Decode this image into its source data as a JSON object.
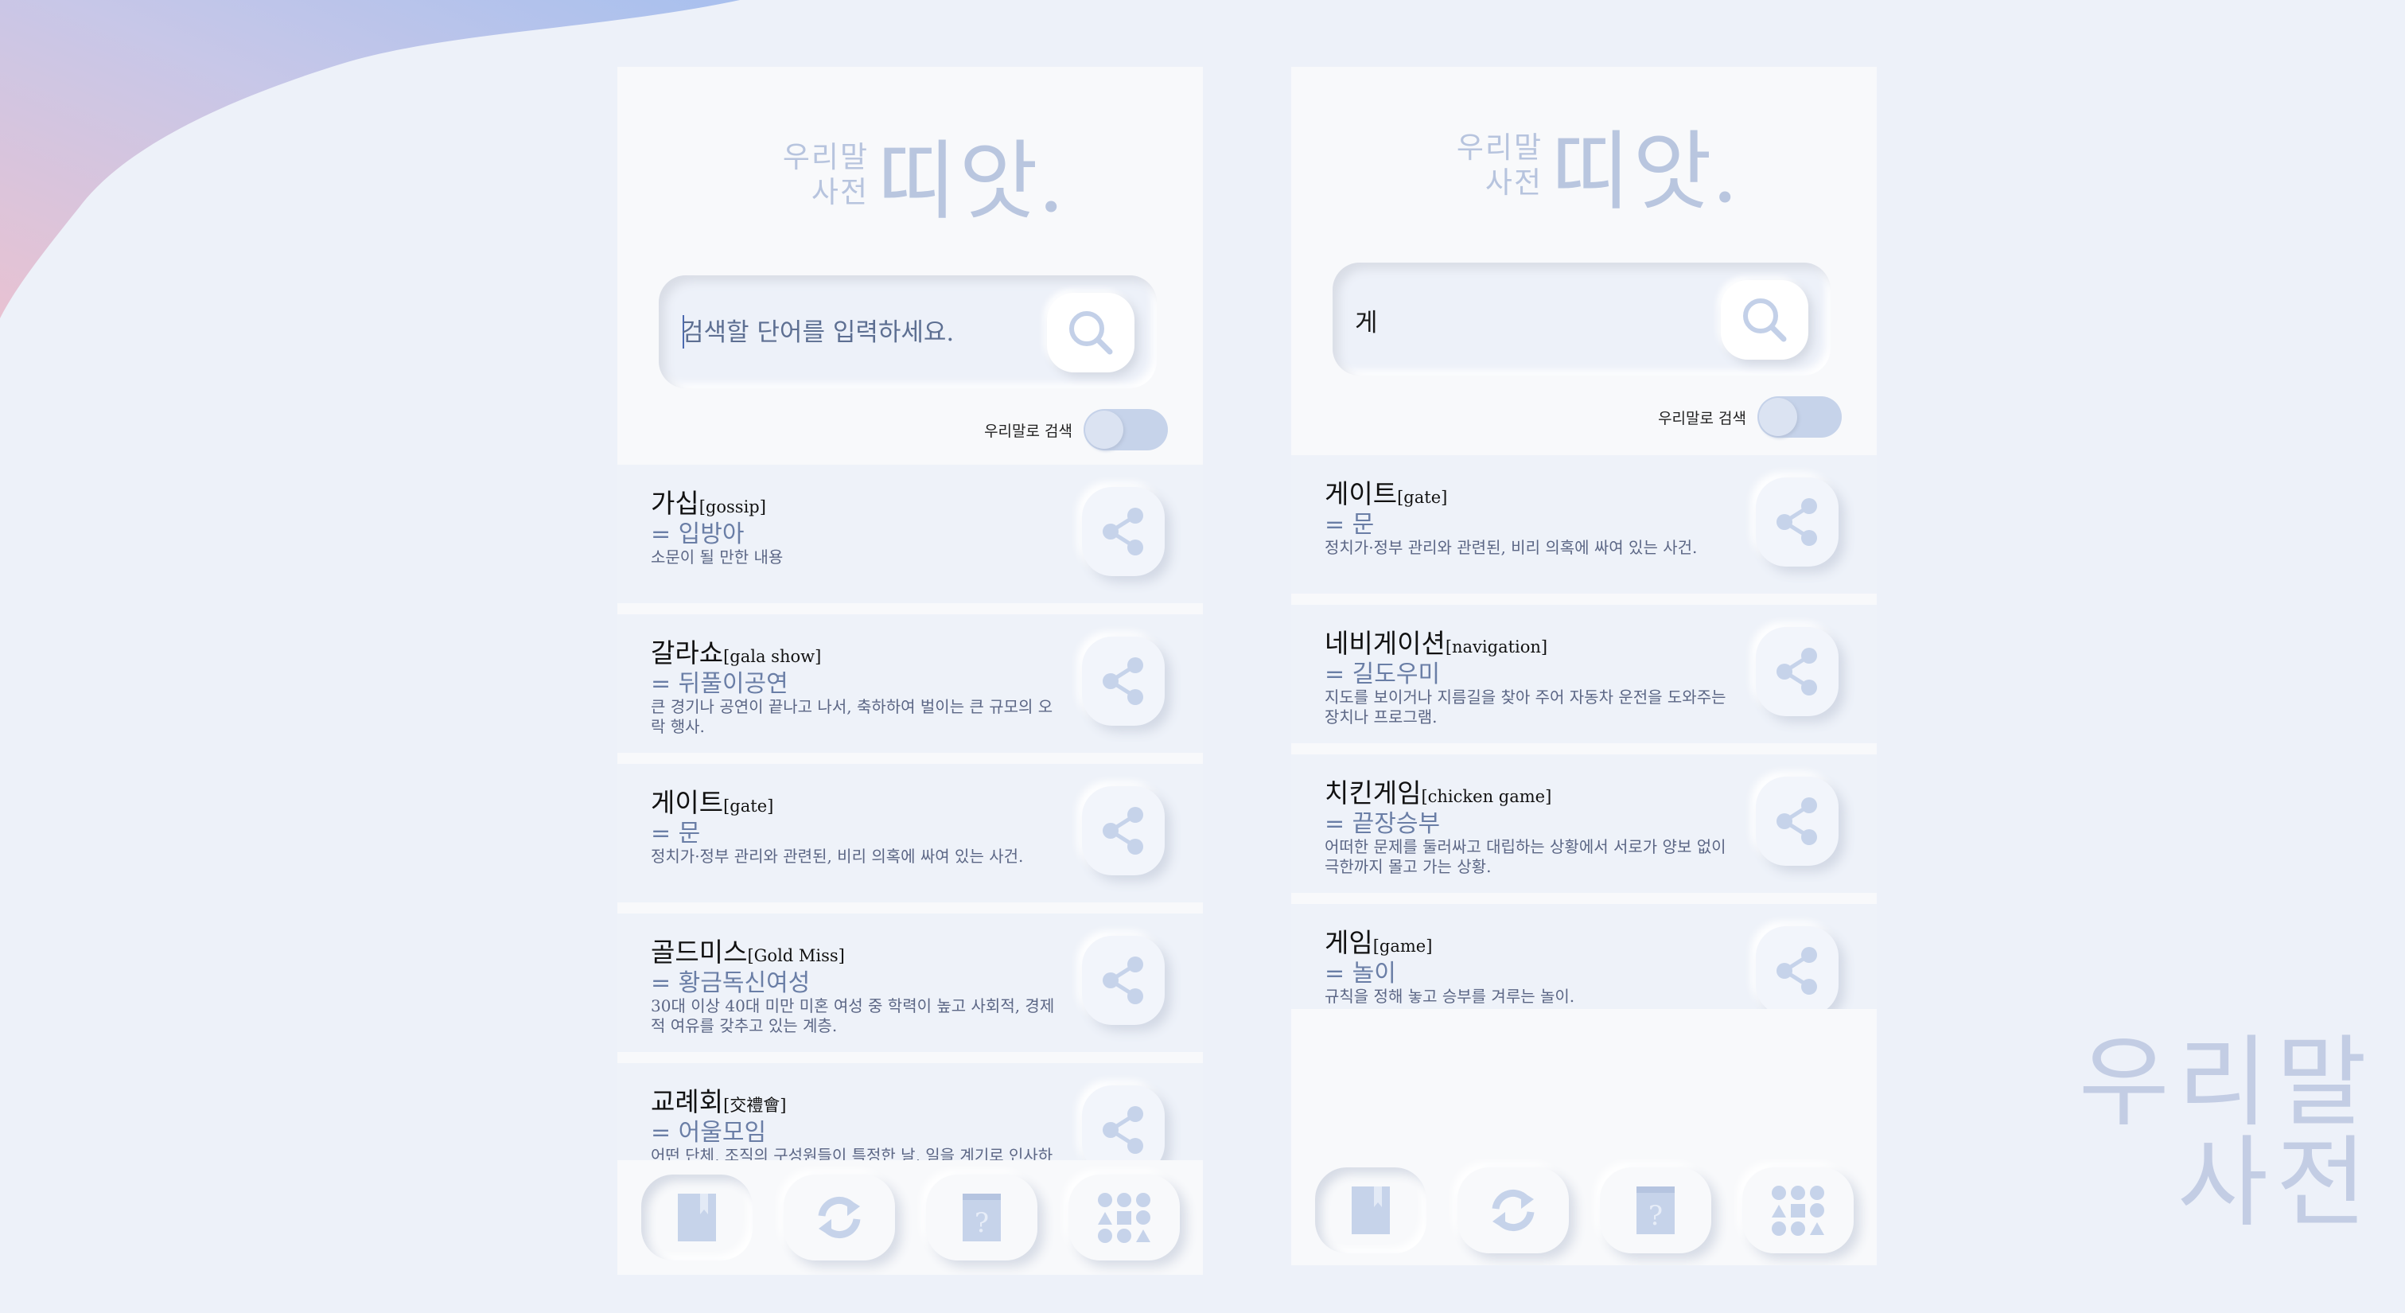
{
  "brand": {
    "logo_small_line1": "우리말",
    "logo_small_line2": "사전",
    "logo_big": "띠앗",
    "logo_dot": ".",
    "watermark_line1": "우리말",
    "watermark_line2": "사전"
  },
  "colors": {
    "accent": "#b9c6df",
    "icon": "#c6d3ea",
    "background": "#edf1f9",
    "card": "#eef2f9"
  },
  "phone1": {
    "search": {
      "placeholder": "검색할 단어를 입력하세요.",
      "value": ""
    },
    "toggle_label": "우리말로 검색",
    "items": [
      {
        "word": "가십",
        "origin": "[gossip]",
        "synonym": "= 입방아",
        "definition": "소문이 될 만한 내용"
      },
      {
        "word": "갈라쇼",
        "origin": "[gala show]",
        "synonym": "= 뒤풀이공연",
        "definition": "큰 경기나 공연이 끝나고 나서, 축하하여 벌이는 큰 규모의 오락 행사."
      },
      {
        "word": "게이트",
        "origin": "[gate]",
        "synonym": "= 문",
        "definition": "정치가·정부 관리와 관련된, 비리 의혹에 싸여 있는 사건."
      },
      {
        "word": "골드미스",
        "origin": "[Gold Miss]",
        "synonym": "= 황금독신여성",
        "definition": "30대 이상 40대 미만 미혼 여성 중 학력이 높고 사회적, 경제적 여유를 갖추고 있는 계층."
      },
      {
        "word": "교례회",
        "origin": "[交禮會]",
        "synonym": "= 어울모임",
        "definition": "어떤 단체, 조직의 구성원들이 특정한 날, 일을 계기로 인사하며 예를 주고받는 모임이나 행사."
      }
    ]
  },
  "phone2": {
    "search": {
      "placeholder": "검색할 단어를 입력하세요.",
      "value": "게"
    },
    "toggle_label": "우리말로 검색",
    "items": [
      {
        "word": "게이트",
        "origin": "[gate]",
        "synonym": "= 문",
        "definition": "정치가·정부 관리와 관련된, 비리 의혹에 싸여 있는 사건."
      },
      {
        "word": "네비게이션",
        "origin": "[navigation]",
        "synonym": "= 길도우미",
        "definition": "지도를 보이거나 지름길을 찾아 주어 자동차 운전을 도와주는 장치나 프로그램."
      },
      {
        "word": "치킨게임",
        "origin": "[chicken game]",
        "synonym": "= 끝장승부",
        "definition": "어떠한 문제를 둘러싸고 대립하는 상황에서 서로가 양보 없이 극한까지 몰고 가는 상황."
      },
      {
        "word": "게임",
        "origin": "[game]",
        "synonym": "= 놀이",
        "definition": "규칙을 정해 놓고 승부를 겨루는 놀이."
      }
    ]
  },
  "bottom_nav": [
    {
      "icon": "book-icon",
      "active": true
    },
    {
      "icon": "refresh-icon",
      "active": false
    },
    {
      "icon": "quiz-card-icon",
      "active": false
    },
    {
      "icon": "shapes-grid-icon",
      "active": false
    }
  ]
}
